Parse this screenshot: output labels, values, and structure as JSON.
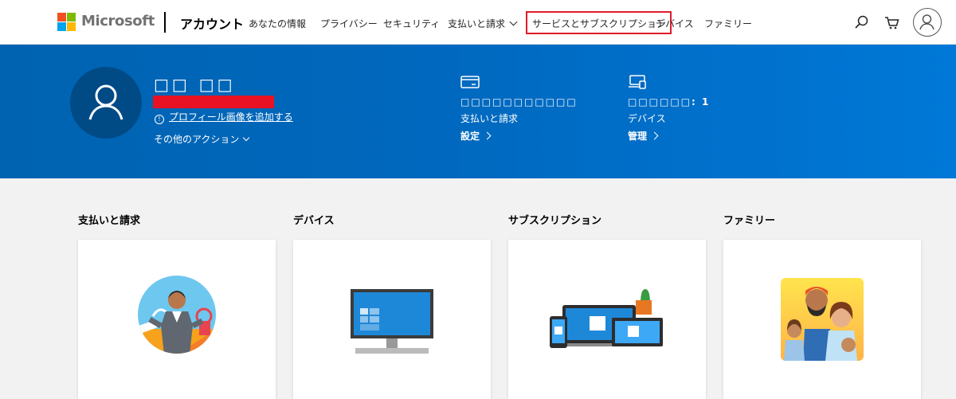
{
  "header": {
    "brand": "Microsoft",
    "section_title": "アカウント",
    "nav": [
      {
        "label": "あなたの情報"
      },
      {
        "label": "プライバシー"
      },
      {
        "label": "セキュリティ"
      },
      {
        "label": "支払いと請求"
      },
      {
        "label": "サービスとサブスクリプション"
      },
      {
        "label": "デバイス"
      },
      {
        "label": "ファミリー"
      }
    ],
    "icons": [
      "search-icon",
      "cart-icon",
      "account-avatar-icon"
    ],
    "colors": {
      "logo_red": "#f25022",
      "logo_green": "#7fba00",
      "logo_blue": "#00a4ef",
      "logo_yellow": "#ffb900",
      "highlight": "#e01b2a"
    }
  },
  "hero": {
    "name": "□□ □□",
    "profile_link": "プロフィール画像を追加する",
    "more_actions": "その他のアクション",
    "billing": {
      "caption": "□□□□□□□□□□□",
      "title": "支払いと請求",
      "link": "設定"
    },
    "devices": {
      "caption": "□□□□□□: 1",
      "title": "デバイス",
      "link": "管理"
    },
    "colors": {
      "start": "#0063b1",
      "end": "#0078d7",
      "avatar_bg": "#004a86"
    }
  },
  "sections": [
    {
      "title": "支払いと請求"
    },
    {
      "title": "デバイス"
    },
    {
      "title": "サブスクリプション"
    },
    {
      "title": "ファミリー"
    }
  ]
}
